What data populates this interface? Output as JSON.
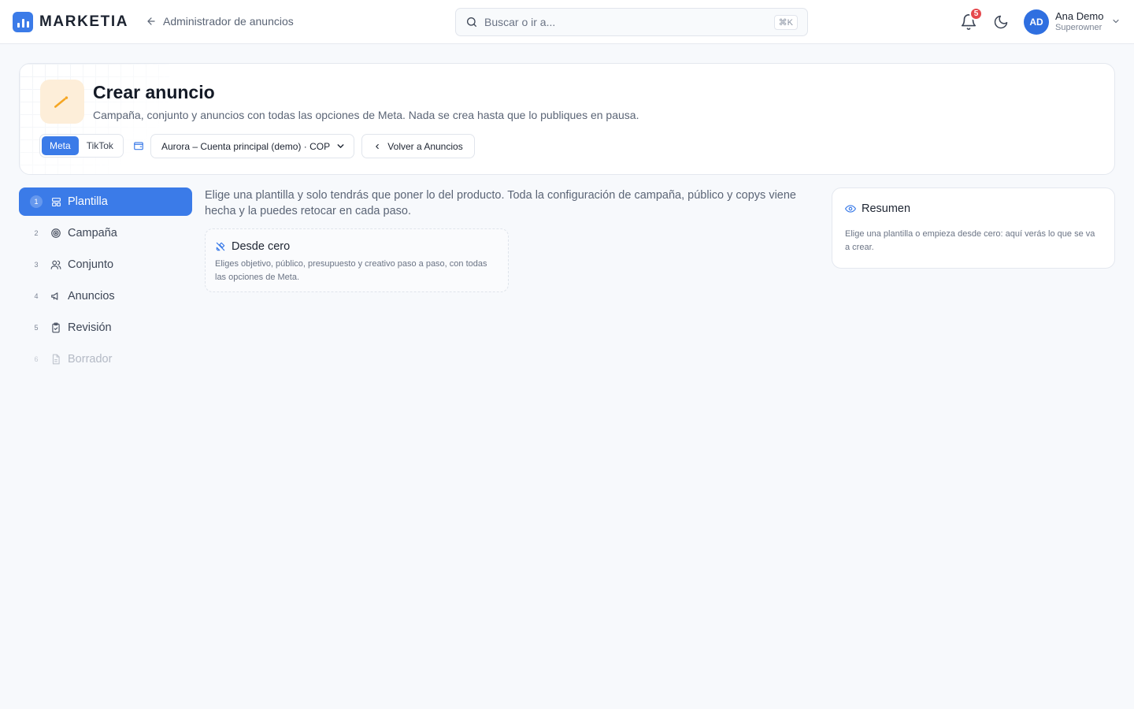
{
  "brand": {
    "name": "MARKETIA",
    "accent": "#3b7be8"
  },
  "topbar": {
    "back_label": "Administrador de anuncios",
    "search_placeholder": "Buscar o ir a...",
    "search_shortcut": "⌘K",
    "notifications_count": "5",
    "user": {
      "initials": "AD",
      "name": "Ana Demo",
      "role": "Superowner"
    }
  },
  "hero": {
    "title": "Crear anuncio",
    "subtitle": "Campaña, conjunto y anuncios con todas las opciones de Meta. Nada se crea hasta que lo publiques en pausa.",
    "platforms": [
      "Meta",
      "TikTok"
    ],
    "selected_platform": "Meta",
    "account": "Aurora – Cuenta principal (demo) · COP",
    "back_button": "Volver a Anuncios"
  },
  "steps": [
    {
      "num": "1",
      "label": "Plantilla",
      "icon": "template-icon",
      "state": "active"
    },
    {
      "num": "2",
      "label": "Campaña",
      "icon": "target-icon",
      "state": "normal"
    },
    {
      "num": "3",
      "label": "Conjunto",
      "icon": "users-icon",
      "state": "normal"
    },
    {
      "num": "4",
      "label": "Anuncios",
      "icon": "megaphone-icon",
      "state": "normal"
    },
    {
      "num": "5",
      "label": "Revisión",
      "icon": "clipboard-check-icon",
      "state": "normal"
    },
    {
      "num": "6",
      "label": "Borrador",
      "icon": "file-icon",
      "state": "disabled"
    }
  ],
  "main": {
    "intro": "Elige una plantilla y solo tendrás que poner lo del producto. Toda la configuración de campaña, público y copys viene hecha y la puedes retocar en cada paso.",
    "template_card": {
      "title": "Desde cero",
      "description": "Eliges objetivo, público, presupuesto y creativo paso a paso, con todas las opciones de Meta."
    }
  },
  "summary": {
    "title": "Resumen",
    "text": "Elige una plantilla o empieza desde cero: aquí verás lo que se va a crear."
  }
}
